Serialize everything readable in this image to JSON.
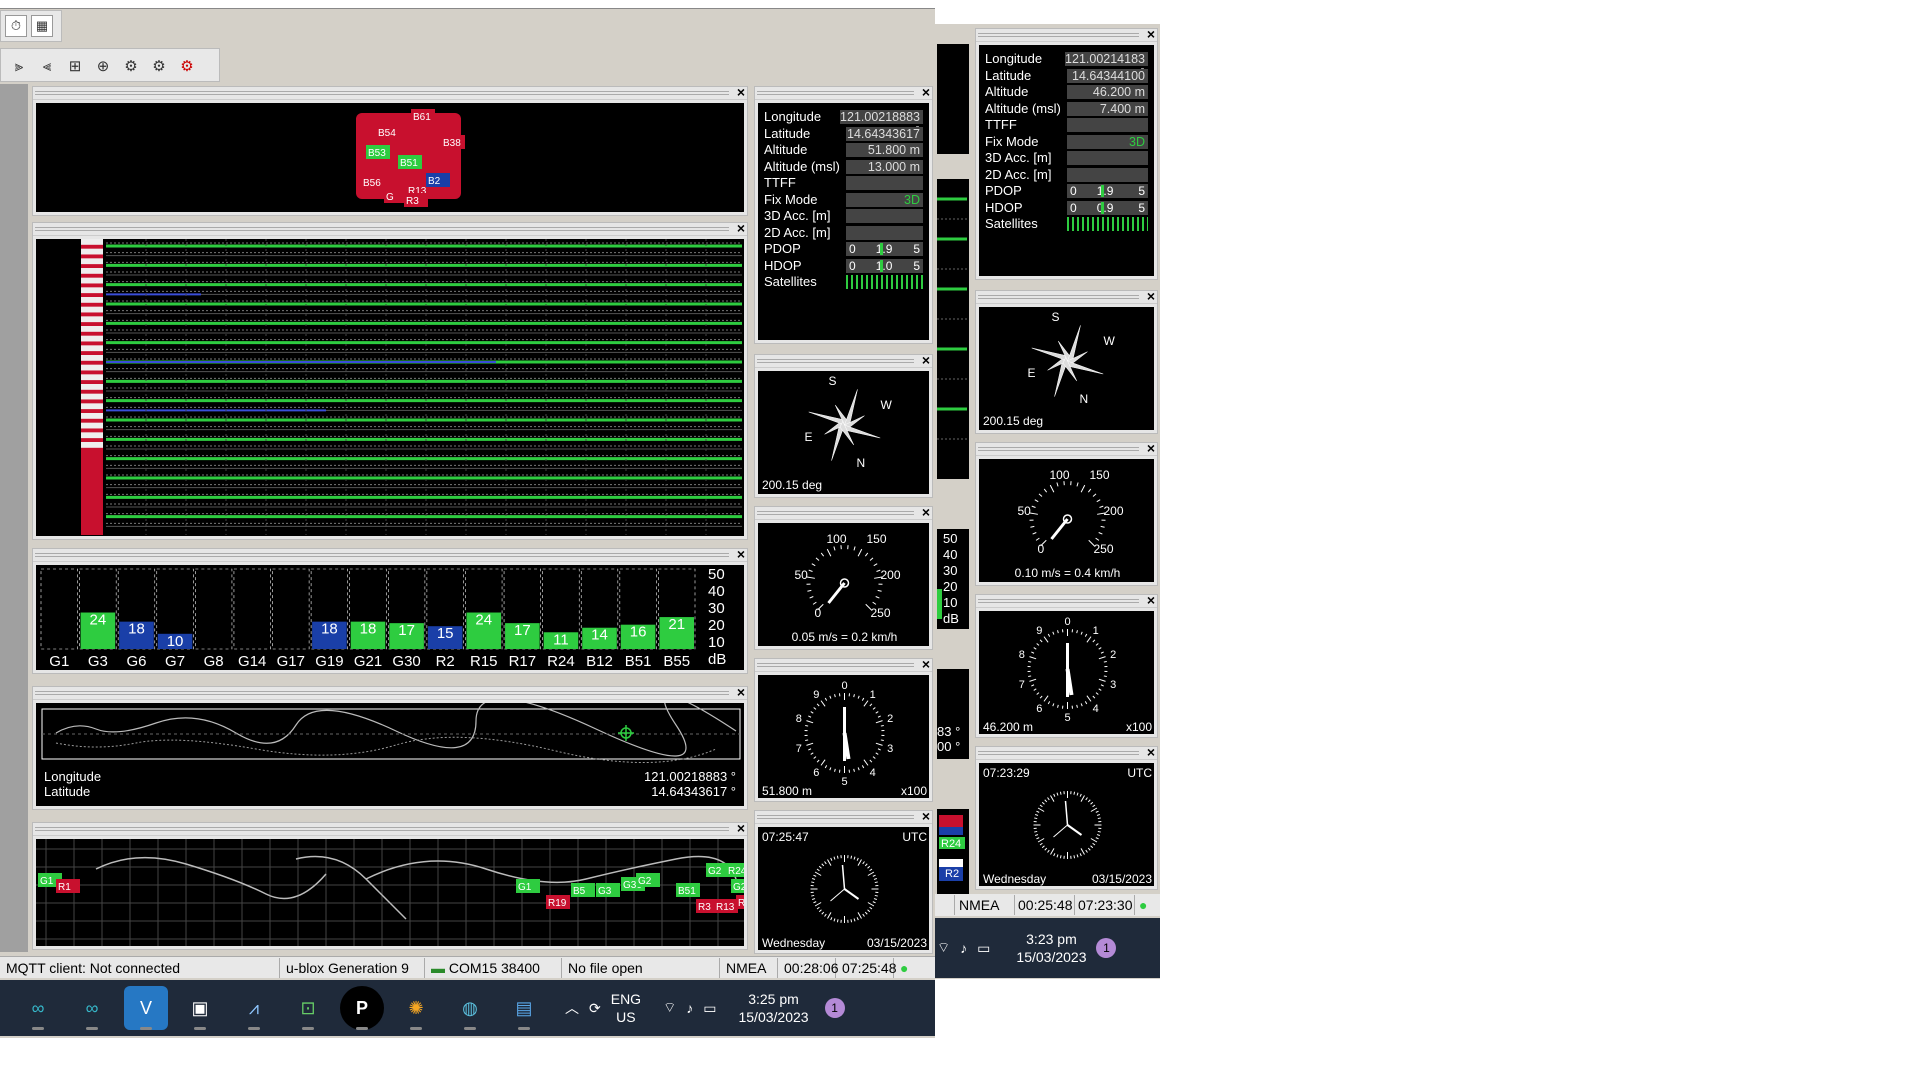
{
  "main": {
    "toolbar_icons": [
      "stopwatch-icon",
      "chart-icon"
    ],
    "toolbar2_icons": [
      "signal-w-icon",
      "signal-c-icon",
      "grid-plus-icon",
      "grid-add-icon",
      "gear-a-icon",
      "gear-b-icon",
      "gear-c-icon"
    ],
    "sky_labels": [
      "B61",
      "B54",
      "B38",
      "B53",
      "B51",
      "B56",
      "R13",
      "G",
      "R3",
      "B2"
    ],
    "info": {
      "rows": [
        {
          "label": "Longitude",
          "value": "121.00218883 °"
        },
        {
          "label": "Latitude",
          "value": "14.64343617 °"
        },
        {
          "label": "Altitude",
          "value": "51.800 m"
        },
        {
          "label": "Altitude (msl)",
          "value": "13.000 m"
        },
        {
          "label": "TTFF",
          "value": ""
        },
        {
          "label": "Fix Mode",
          "value": "3D"
        },
        {
          "label": "3D Acc. [m]",
          "value": ""
        },
        {
          "label": "2D Acc. [m]",
          "value": ""
        }
      ],
      "pdop": {
        "label": "PDOP",
        "min": "0",
        "val": "1.9",
        "max": "5"
      },
      "hdop": {
        "label": "HDOP",
        "min": "0",
        "val": "1.0",
        "max": "5"
      },
      "sat_label": "Satellites"
    },
    "compass": {
      "S": "S",
      "W": "W",
      "E": "E",
      "N": "N",
      "deg": "200.15 deg"
    },
    "speed": {
      "ticks": [
        "100",
        "150",
        "50",
        "200",
        "0",
        "250"
      ],
      "text": "0.05 m/s = 0.2 km/h"
    },
    "altimeter": {
      "value": "51.800 m",
      "mult": "x100",
      "ticks": [
        "0",
        "1",
        "2",
        "3",
        "4",
        "5",
        "6",
        "7",
        "8",
        "9"
      ]
    },
    "clock": {
      "time": "07:25:47",
      "tz": "UTC",
      "day": "Wednesday",
      "date": "03/15/2023"
    },
    "cn": {
      "sats": [
        "G1",
        "G3",
        "G6",
        "G7",
        "G8",
        "G14",
        "G17",
        "G19",
        "G21",
        "G30",
        "R2",
        "R15",
        "R17",
        "R24",
        "B12",
        "B51",
        "B55"
      ],
      "values": [
        0,
        24,
        18,
        10,
        0,
        0,
        0,
        18,
        18,
        17,
        15,
        24,
        17,
        11,
        14,
        16,
        21
      ],
      "yticks": [
        "50",
        "40",
        "30",
        "20",
        "10",
        "dB"
      ]
    },
    "map": {
      "lon_label": "Longitude",
      "lat_label": "Latitude",
      "lon": "121.00218883 °",
      "lat": "14.64343617 °"
    },
    "sat_map_labels": [
      "G1",
      "R1",
      "G1",
      "R19",
      "B5",
      "G3",
      "G30",
      "G2",
      "B51",
      "G2",
      "R24",
      "R3",
      "R13",
      "R5",
      "G2"
    ],
    "status": {
      "mqtt": "MQTT client: Not connected",
      "receiver": "u-blox Generation 9",
      "port": "COM15 38400",
      "file": "No file open",
      "protocol": "NMEA",
      "elapsed": "00:28:06",
      "time": "07:25:48"
    },
    "taskbar": {
      "lang": "ENG",
      "region": "US",
      "time": "3:25 pm",
      "date": "15/03/2023",
      "badge": "1"
    }
  },
  "right": {
    "info": {
      "rows": [
        {
          "label": "Longitude",
          "value": "121.00214183 °"
        },
        {
          "label": "Latitude",
          "value": "14.64344100 °"
        },
        {
          "label": "Altitude",
          "value": "46.200 m"
        },
        {
          "label": "Altitude (msl)",
          "value": "7.400 m"
        },
        {
          "label": "TTFF",
          "value": ""
        },
        {
          "label": "Fix Mode",
          "value": "3D"
        },
        {
          "label": "3D Acc. [m]",
          "value": ""
        },
        {
          "label": "2D Acc. [m]",
          "value": ""
        }
      ],
      "pdop": {
        "label": "PDOP",
        "min": "0",
        "val": "1.9",
        "max": "5"
      },
      "hdop": {
        "label": "HDOP",
        "min": "0",
        "val": "0.9",
        "max": "5"
      },
      "sat_label": "Satellites"
    },
    "compass": {
      "S": "S",
      "W": "W",
      "E": "E",
      "N": "N",
      "deg": "200.15 deg"
    },
    "speed": {
      "ticks": [
        "100",
        "150",
        "50",
        "200",
        "0",
        "250"
      ],
      "text": "0.10 m/s = 0.4 km/h"
    },
    "altimeter": {
      "value": "46.200 m",
      "mult": "x100",
      "ticks": [
        "0",
        "1",
        "2",
        "3",
        "4",
        "5",
        "6",
        "7",
        "8",
        "9"
      ]
    },
    "clock": {
      "time": "07:23:29",
      "tz": "UTC",
      "day": "Wednesday",
      "date": "03/15/2023"
    },
    "cn_ticks": [
      "50",
      "40",
      "30",
      "20",
      "10",
      "dB"
    ],
    "partial_labels": [
      "83 °",
      "00 °"
    ],
    "flags": [
      "R24",
      "R2"
    ],
    "status": {
      "protocol": "NMEA",
      "elapsed": "00:25:48",
      "time": "07:23:30"
    },
    "taskbar": {
      "time": "3:23 pm",
      "date": "15/03/2023",
      "badge": "1"
    }
  }
}
